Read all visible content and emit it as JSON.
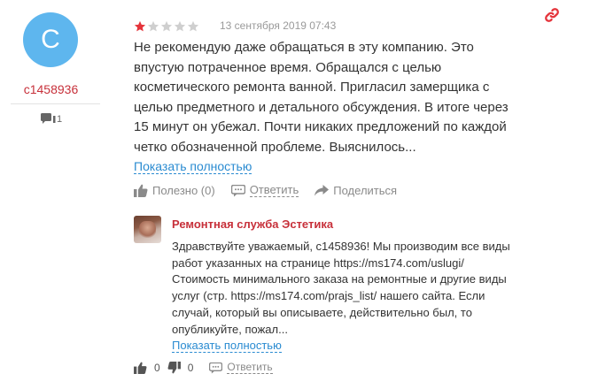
{
  "author": {
    "avatar_letter": "C",
    "avatar_color": "#5eb6ee",
    "name": "c1458936",
    "comments_count": "1",
    "comments_icon": "comments-icon"
  },
  "review": {
    "rating": 1,
    "rating_max": 5,
    "star_filled_color": "#e5343b",
    "star_empty_color": "#cfcfcf",
    "date": "13 сентября 2019 07:43",
    "link_icon": "link-icon",
    "lines": [
      "Не рекомендую даже обращаться в эту компанию. Это",
      "впустую потраченное время. Обращался с целью",
      "косметического ремонта ванной. Пригласил замерщика с",
      "целью предметного и детального обсуждения. В итоге через",
      "15 минут он убежал. Почти никаких предложений по каждой",
      "четко обозначенной проблеме. Выяснилось..."
    ],
    "show_more": "Показать полностью",
    "actions": {
      "useful": "Полезно (0)",
      "reply": "Ответить",
      "share": "Поделиться"
    }
  },
  "reply": {
    "company": "Ремонтная служба Эстетика",
    "lines": [
      "Здравствуйте уважаемый, с1458936! Мы производим все виды",
      "работ указанных на странице https://ms174.com/uslugi/",
      "Стоимость минимального заказа на ремонтные и другие виды",
      "услуг (стр. https://ms174.com/prajs_list/ нашего сайта. Если",
      "случай, который вы описываете, действительно был, то",
      "опубликуйте, пожал..."
    ],
    "show_more": "Показать полностью",
    "likes": "0",
    "dislikes": "0",
    "reply_label": "Ответить"
  },
  "colors": {
    "accent_red": "#c7303a",
    "link_blue": "#2a8bd1",
    "muted_gray": "#8a8a8a"
  }
}
